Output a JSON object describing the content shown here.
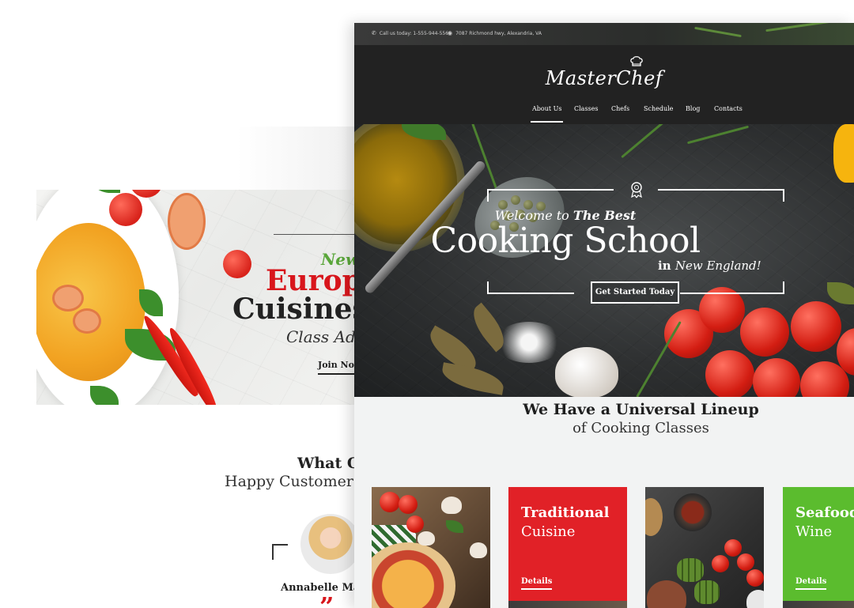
{
  "back_page": {
    "banner": {
      "eyebrow": "New",
      "title_line1": "Europ",
      "title_line2": "Cuisines",
      "subtitle": "Class Add",
      "cta_label": "Join Now!"
    },
    "testimonials": {
      "title": "What O",
      "subtitle": "Happy Customer S",
      "customer_name": "Annabelle May",
      "quote_mark": "”"
    }
  },
  "front_page": {
    "topbar": {
      "phone_text": "Call us today: 1-555-944-5566",
      "address_text": "7087 Richmond hwy, Alexandria, VA"
    },
    "header": {
      "logo_text": "MasterChef",
      "nav": [
        {
          "label": "About Us",
          "active": true
        },
        {
          "label": "Classes",
          "active": false
        },
        {
          "label": "Chefs",
          "active": false
        },
        {
          "label": "Schedule",
          "active": false
        },
        {
          "label": "Blog",
          "active": false
        },
        {
          "label": "Contacts",
          "active": false
        }
      ]
    },
    "hero": {
      "welcome_prefix": "Welcome to ",
      "welcome_emphasis": "The Best",
      "headline": "Cooking School",
      "tagline_prefix": "in ",
      "tagline_rest": "New England!",
      "cta_label": "Get Started Today"
    },
    "classes": {
      "title": "We Have a Universal Lineup",
      "subtitle": "of Cooking Classes",
      "cards": [
        {
          "title": "Traditional",
          "subtitle": "Cuisine",
          "details_label": "Details",
          "color": "#e12127"
        },
        {
          "title": "Seafood",
          "subtitle": "Wine",
          "details_label": "Details",
          "color": "#5bbc2e"
        }
      ]
    }
  },
  "colors": {
    "brand_red": "#e12127",
    "brand_green": "#5bbc2e",
    "header_dark": "#222222"
  },
  "icons": [
    "phone-icon",
    "map-pin-icon",
    "chef-hat-icon",
    "award-icon"
  ]
}
